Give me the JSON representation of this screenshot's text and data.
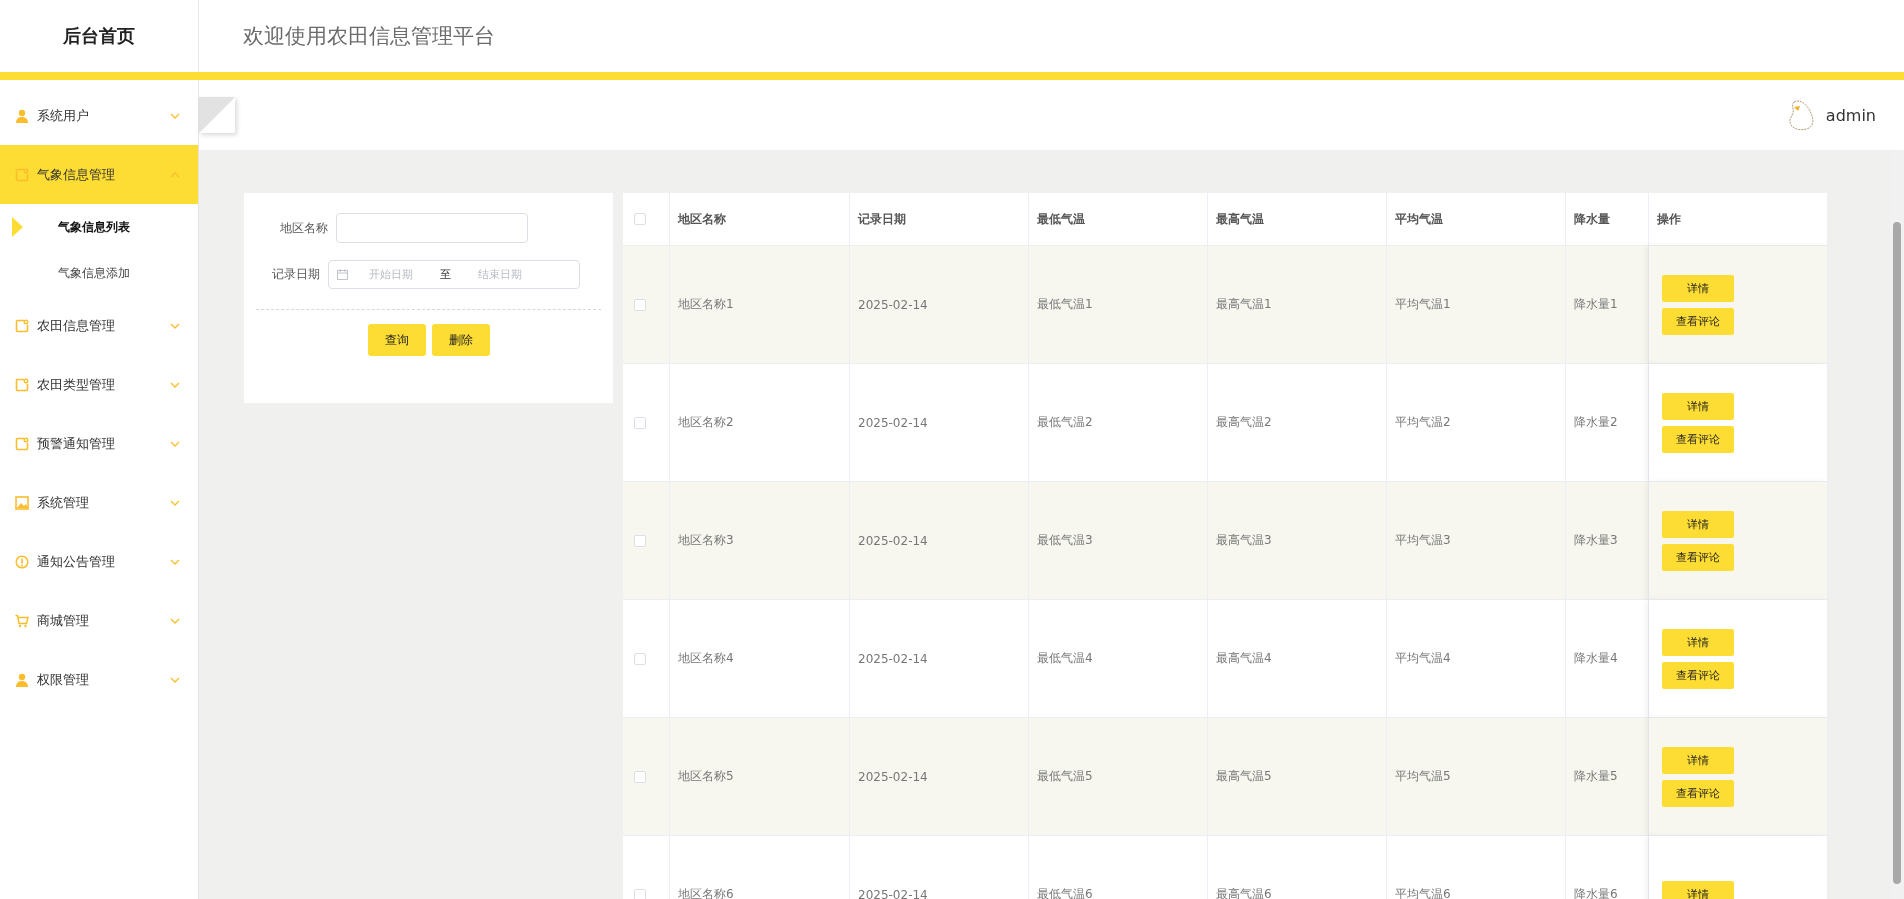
{
  "sidebar": {
    "title": "后台首页",
    "items": [
      {
        "label": "系统用户",
        "kind": "user",
        "expanded": false,
        "selected": false
      },
      {
        "label": "气象信息管理",
        "kind": "note",
        "expanded": true,
        "selected": true,
        "children": [
          {
            "label": "气象信息列表",
            "selected": true
          },
          {
            "label": "气象信息添加",
            "selected": false
          }
        ]
      },
      {
        "label": "农田信息管理",
        "kind": "note",
        "expanded": false,
        "selected": false
      },
      {
        "label": "农田类型管理",
        "kind": "note",
        "expanded": false,
        "selected": false
      },
      {
        "label": "预警通知管理",
        "kind": "note",
        "expanded": false,
        "selected": false
      },
      {
        "label": "系统管理",
        "kind": "picture",
        "expanded": false,
        "selected": false
      },
      {
        "label": "通知公告管理",
        "kind": "info",
        "expanded": false,
        "selected": false
      },
      {
        "label": "商城管理",
        "kind": "cart",
        "expanded": false,
        "selected": false
      },
      {
        "label": "权限管理",
        "kind": "user",
        "expanded": false,
        "selected": false
      }
    ]
  },
  "header": {
    "title": "欢迎使用农田信息管理平台"
  },
  "user": {
    "name": "admin"
  },
  "filter": {
    "fields": [
      {
        "kind": "text",
        "label": "地区名称"
      },
      {
        "kind": "daterange",
        "label": "记录日期",
        "start_placeholder": "开始日期",
        "separator": "至",
        "end_placeholder": "结束日期"
      }
    ],
    "buttons": [
      "查询",
      "删除"
    ]
  },
  "table": {
    "all_checked": false,
    "columns": [
      "地区名称",
      "记录日期",
      "最低气温",
      "最高气温",
      "平均气温",
      "降水量",
      "操作"
    ],
    "rows": [
      {
        "checked": false,
        "cells": [
          "地区名称1",
          "2025-02-14",
          "最低气温1",
          "最高气温1",
          "平均气温1",
          "降水量1"
        ],
        "actions": [
          "详情",
          "查看评论"
        ]
      },
      {
        "checked": false,
        "cells": [
          "地区名称2",
          "2025-02-14",
          "最低气温2",
          "最高气温2",
          "平均气温2",
          "降水量2"
        ],
        "actions": [
          "详情",
          "查看评论"
        ]
      },
      {
        "checked": false,
        "cells": [
          "地区名称3",
          "2025-02-14",
          "最低气温3",
          "最高气温3",
          "平均气温3",
          "降水量3"
        ],
        "actions": [
          "详情",
          "查看评论"
        ]
      },
      {
        "checked": false,
        "cells": [
          "地区名称4",
          "2025-02-14",
          "最低气温4",
          "最高气温4",
          "平均气温4",
          "降水量4"
        ],
        "actions": [
          "详情",
          "查看评论"
        ]
      },
      {
        "checked": false,
        "cells": [
          "地区名称5",
          "2025-02-14",
          "最低气温5",
          "最高气温5",
          "平均气温5",
          "降水量5"
        ],
        "actions": [
          "详情",
          "查看评论"
        ]
      },
      {
        "checked": false,
        "cells": [
          "地区名称6",
          "2025-02-14",
          "最低气温6",
          "最高气温6",
          "平均气温6",
          "降水量6"
        ],
        "actions": [
          "详情"
        ]
      }
    ]
  }
}
